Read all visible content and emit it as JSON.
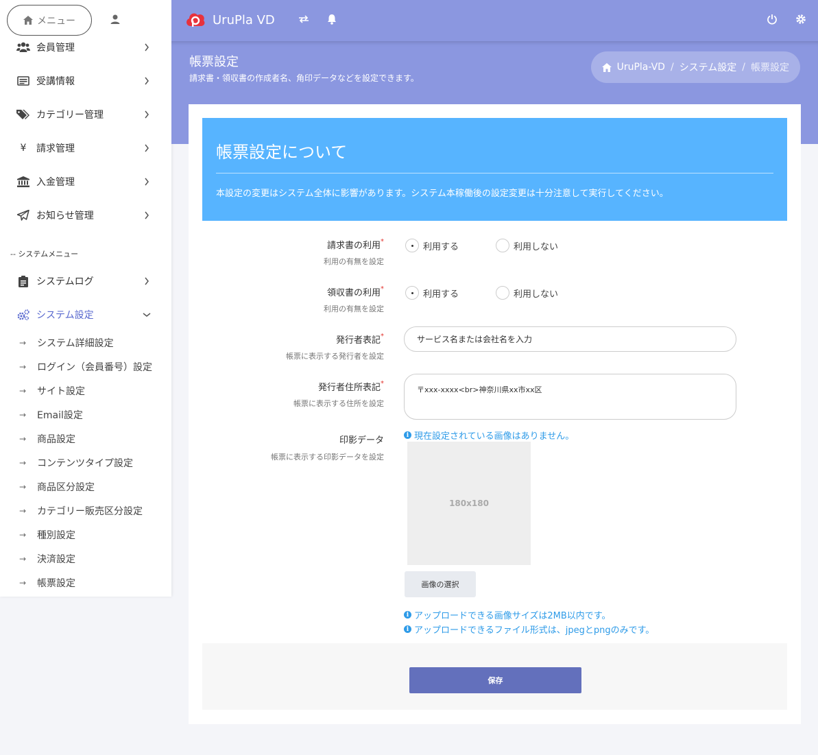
{
  "header": {
    "brand": "UruPla VD",
    "icons": [
      "transfer-icon",
      "bell-icon",
      "power-icon",
      "gear-icon"
    ]
  },
  "page": {
    "title": "帳票設定",
    "subtitle": "請求書・領収書の作成者名、角印データなどを設定できます。"
  },
  "breadcrumb": {
    "home": "UruPla-VD",
    "sep": "/",
    "level2": "システム設定",
    "current": "帳票設定"
  },
  "sidebar": {
    "menu_label": "メニュー",
    "items": [
      {
        "label": "会員管理",
        "icon": "users-icon"
      },
      {
        "label": "受講情報",
        "icon": "id-card-icon"
      },
      {
        "label": "カテゴリー管理",
        "icon": "tags-icon"
      },
      {
        "label": "請求管理",
        "icon": "yen-icon"
      },
      {
        "label": "入金管理",
        "icon": "bank-icon"
      },
      {
        "label": "お知らせ管理",
        "icon": "paper-plane-icon"
      }
    ],
    "system_section": "-- システムメニュー",
    "system_items": [
      {
        "label": "システムログ",
        "icon": "clipboard-icon"
      },
      {
        "label": "システム設定",
        "icon": "cogs-icon"
      }
    ],
    "sub_items": [
      "システム詳細設定",
      "ログイン（会員番号）設定",
      "サイト設定",
      "Email設定",
      "商品設定",
      "コンテンツタイプ設定",
      "商品区分設定",
      "カテゴリー販売区分設定",
      "種別設定",
      "決済設定",
      "帳票設定"
    ],
    "arrow": "→"
  },
  "notice": {
    "title": "帳票設定について",
    "body": "本設定の変更はシステム全体に影響があります。システム本稼働後の設定変更は十分注意して実行してください。"
  },
  "form": {
    "required_mark": "*",
    "invoice": {
      "label": "請求書の利用",
      "hint": "利用の有無を設定",
      "opt_yes": "利用する",
      "opt_no": "利用しない"
    },
    "receipt": {
      "label": "領収書の利用",
      "hint": "利用の有無を設定",
      "opt_yes": "利用する",
      "opt_no": "利用しない"
    },
    "issuer": {
      "label": "発行者表記",
      "hint": "帳票に表示する発行者を設定",
      "value": "サービス名または会社名を入力"
    },
    "address": {
      "label": "発行者住所表記",
      "hint": "帳票に表示する住所を設定",
      "value": "〒xxx-xxxx<br>神奈川県xx市xx区"
    },
    "seal": {
      "label": "印影データ",
      "hint": "帳票に表示する印影データを設定",
      "no_image": "現在設定されている画像はありません。",
      "placeholder": "180x180",
      "select_button": "画像の選択",
      "note_size": "アップロードできる画像サイズは2MB以内です。",
      "note_format": "アップロードできるファイル形式は、jpegとpngのみです。",
      "info_glyph": "i"
    },
    "save": "保存"
  }
}
